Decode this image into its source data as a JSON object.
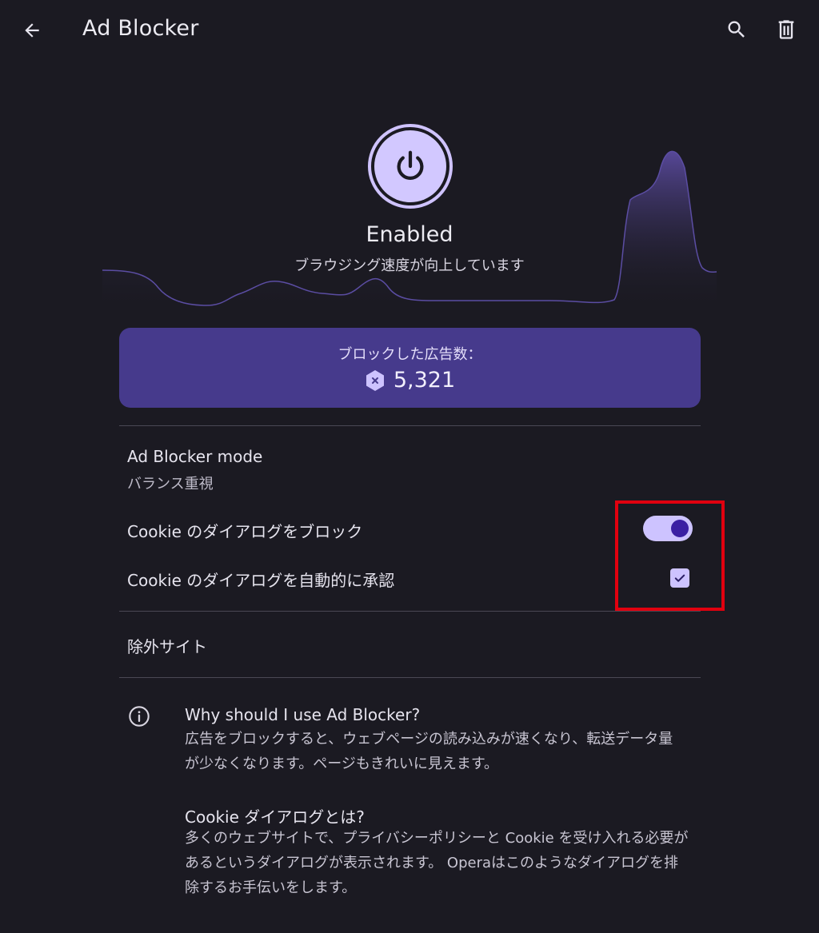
{
  "appbar": {
    "title": "Ad Blocker",
    "icons": [
      "arrow-back-icon",
      "search-icon",
      "delete-icon"
    ]
  },
  "hero": {
    "status": "Enabled",
    "subtitle": "ブラウジング速度が向上しています",
    "icon": "power-icon"
  },
  "blocked": {
    "label": "ブロックした広告数：",
    "count": "5,321",
    "icon": "blocked-hexagon-icon"
  },
  "settings": {
    "mode_title": "Ad Blocker mode",
    "mode_value": "バランス重視",
    "cookie_block_label": "Cookie のダイアログをブロック",
    "cookie_block_enabled": true,
    "cookie_accept_label": "Cookie のダイアログを自動的に承認",
    "cookie_accept_checked": true,
    "exceptions_label": "除外サイト"
  },
  "info": {
    "icon": "info-icon",
    "q1_title": "Why should I use Ad Blocker?",
    "q1_line1": "広告をブロックすると、ウェブページの読み込みが速くなり、転送データ量",
    "q1_line2": "が少なくなります。ページもきれいに見えます。",
    "q2_title": "Cookie ダイアログとは?",
    "q2_line1": "多くのウェブサイトで、プライバシーポリシーと Cookie を受け入れる必要が",
    "q2_line2": "あるというダイアログが表示されます。 Operaはこのようなダイアログを排",
    "q2_line3": "除するお手伝いをします。"
  },
  "colors": {
    "background": "#1b1a22",
    "accent": "#cdc3ff",
    "card": "#463a8c",
    "highlight": "#e1000f"
  }
}
